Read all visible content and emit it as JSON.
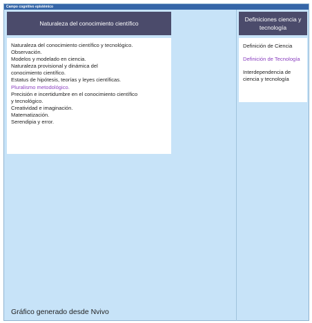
{
  "window": {
    "title": "Campo cognitivo epistémico"
  },
  "colors": {
    "background": "#c7e3f8",
    "header": "#4b4b6b",
    "highlight": "#8a3fbf",
    "titlebar": "#3566a8"
  },
  "left_panel": {
    "header": "Naturaleza del conocimiento científico",
    "items": [
      {
        "text": "Naturaleza del conocimiento científico y tecnológico.",
        "highlight": false
      },
      {
        "text": "Observación.",
        "highlight": false
      },
      {
        "text": "Modelos y modelado en ciencia.",
        "highlight": false
      },
      {
        "text": "Naturaleza provisional y dinámica del\nconocimiento científico.",
        "highlight": false
      },
      {
        "text": "Estatus de hipótesis, teorías y leyes científicas.",
        "highlight": false
      },
      {
        "text": "Pluralismo metodológico.",
        "highlight": true
      },
      {
        "text": "Precisión e incertidumbre en el conocimiento científico\ny tecnológico.",
        "highlight": false
      },
      {
        "text": "Creatividad e imaginación.",
        "highlight": false
      },
      {
        "text": "Matematización.",
        "highlight": false
      },
      {
        "text": "Serendipia y error.",
        "highlight": false
      }
    ]
  },
  "right_panel": {
    "header": "Definiciones ciencia y tecnología",
    "items": [
      {
        "text": "Definición de Ciencia",
        "highlight": false
      },
      {
        "text": "Definición de Tecnología",
        "highlight": true
      },
      {
        "text": "Interdependencia de\nciencia y tecnología",
        "highlight": false
      }
    ]
  },
  "caption": "Gráfico generado desde Nvivo"
}
